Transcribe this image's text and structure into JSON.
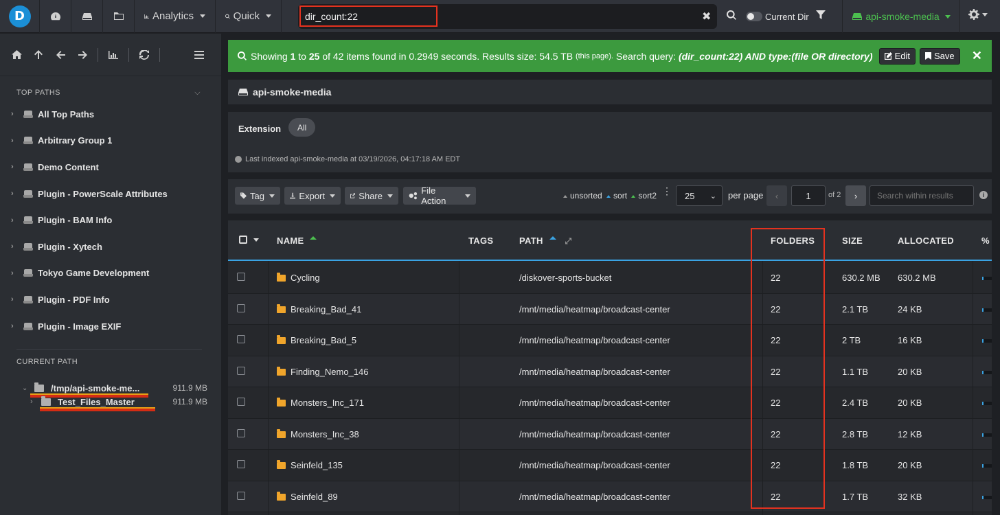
{
  "topbar": {
    "logo_letter": "D",
    "analytics_label": "Analytics",
    "quick_label": "Quick",
    "search_value": "dir_count:22",
    "current_dir_label": "Current Dir",
    "index_name": "api-smoke-media"
  },
  "sidebar": {
    "top_paths_heading": "TOP PATHS",
    "top_paths": [
      "All Top Paths",
      "Arbitrary Group 1",
      "Demo Content",
      "Plugin - PowerScale Attributes",
      "Plugin - BAM Info",
      "Plugin - Xytech",
      "Tokyo Game Development",
      "Plugin - PDF Info",
      "Plugin - Image EXIF"
    ],
    "current_path_heading": "CURRENT PATH",
    "current_path": {
      "name": "/tmp/api-smoke-me...",
      "size": "911.9 MB"
    },
    "child_path": {
      "name": "Test_Files_Master",
      "size": "911.9 MB"
    }
  },
  "alert": {
    "prefix": "Showing",
    "from": "1",
    "to_word": "to",
    "to": "25",
    "rest": "of 42 items found in 0.2949 seconds. Results size: 54.5 TB",
    "this_page": "(this page).",
    "query_label": "Search query:",
    "query": "(dir_count:22) AND type:(file OR directory)",
    "edit_label": "Edit",
    "save_label": "Save"
  },
  "panel": {
    "title": "api-smoke-media",
    "extension_label": "Extension",
    "extension_all": "All",
    "last_indexed": "Last indexed api-smoke-media at 03/19/2026, 04:17:18 AM EDT"
  },
  "toolbar": {
    "tag_label": "Tag",
    "export_label": "Export",
    "share_label": "Share",
    "file_action_label": "File Action",
    "unsorted_label": "unsorted",
    "sort_label": "sort",
    "sort2_label": "sort2",
    "per_page_value": "25",
    "per_page_label": "per page",
    "page_value": "1",
    "page_of": "of 2",
    "search_placeholder": "Search within results"
  },
  "table": {
    "headers": {
      "name": "NAME",
      "tags": "TAGS",
      "path": "PATH",
      "folders": "FOLDERS",
      "size": "SIZE",
      "allocated": "ALLOCATED",
      "pct": "%"
    },
    "rows": [
      {
        "name": "Cycling",
        "path": "/diskover-sports-bucket",
        "folders": "22",
        "size": "630.2 MB",
        "allocated": "630.2 MB"
      },
      {
        "name": "Breaking_Bad_41",
        "path": "/mnt/media/heatmap/broadcast-center",
        "folders": "22",
        "size": "2.1 TB",
        "allocated": "24 KB"
      },
      {
        "name": "Breaking_Bad_5",
        "path": "/mnt/media/heatmap/broadcast-center",
        "folders": "22",
        "size": "2 TB",
        "allocated": "16 KB"
      },
      {
        "name": "Finding_Nemo_146",
        "path": "/mnt/media/heatmap/broadcast-center",
        "folders": "22",
        "size": "1.1 TB",
        "allocated": "20 KB"
      },
      {
        "name": "Monsters_Inc_171",
        "path": "/mnt/media/heatmap/broadcast-center",
        "folders": "22",
        "size": "2.4 TB",
        "allocated": "20 KB"
      },
      {
        "name": "Monsters_Inc_38",
        "path": "/mnt/media/heatmap/broadcast-center",
        "folders": "22",
        "size": "2.8 TB",
        "allocated": "12 KB"
      },
      {
        "name": "Seinfeld_135",
        "path": "/mnt/media/heatmap/broadcast-center",
        "folders": "22",
        "size": "1.8 TB",
        "allocated": "20 KB"
      },
      {
        "name": "Seinfeld_89",
        "path": "/mnt/media/heatmap/broadcast-center",
        "folders": "22",
        "size": "1.7 TB",
        "allocated": "32 KB"
      }
    ]
  },
  "colors": {
    "accent_blue": "#3aa3e3",
    "success_green": "#3c9a3e",
    "index_green": "#4cc04f",
    "highlight_red": "#e4321f",
    "folder_orange": "#f0a52b"
  }
}
